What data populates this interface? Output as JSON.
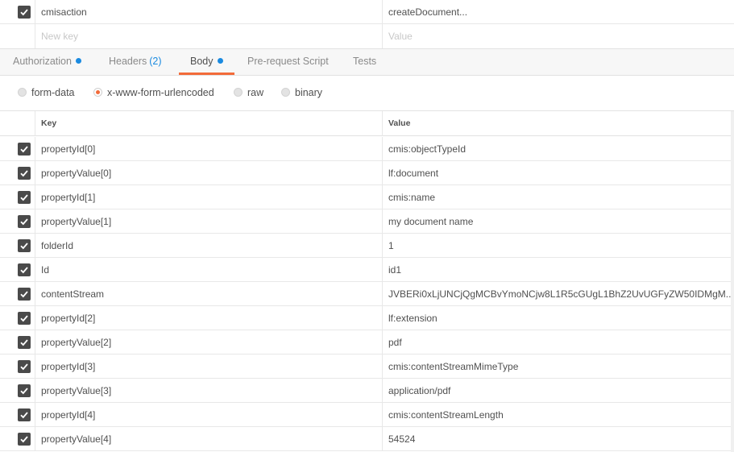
{
  "params": {
    "row": {
      "key": "cmisaction",
      "value": "createDocument..."
    },
    "new_key_placeholder": "New key",
    "new_value_placeholder": "Value"
  },
  "tabs": [
    {
      "label": "Authorization",
      "dot": true
    },
    {
      "label": "Headers",
      "count": "(2)"
    },
    {
      "label": "Body",
      "dot": true,
      "active": true
    },
    {
      "label": "Pre-request Script"
    },
    {
      "label": "Tests"
    }
  ],
  "body_modes": [
    {
      "label": "form-data",
      "selected": false
    },
    {
      "label": "x-www-form-urlencoded",
      "selected": true
    },
    {
      "label": "raw",
      "selected": false
    },
    {
      "label": "binary",
      "selected": false
    }
  ],
  "table": {
    "header_key": "Key",
    "header_value": "Value",
    "rows": [
      {
        "key": "propertyId[0]",
        "value": "cmis:objectTypeId"
      },
      {
        "key": "propertyValue[0]",
        "value": "lf:document"
      },
      {
        "key": "propertyId[1]",
        "value": "cmis:name"
      },
      {
        "key": "propertyValue[1]",
        "value": "my document name"
      },
      {
        "key": "folderId",
        "value": "1"
      },
      {
        "key": "Id",
        "value": "id1"
      },
      {
        "key": "contentStream",
        "value": "JVBERi0xLjUNCjQgMCBvYmoNCjw8L1R5cGUgL1BhZ2UvUGFyZW50IDMgM..."
      },
      {
        "key": "propertyId[2]",
        "value": "lf:extension"
      },
      {
        "key": "propertyValue[2]",
        "value": "pdf"
      },
      {
        "key": "propertyId[3]",
        "value": "cmis:contentStreamMimeType"
      },
      {
        "key": "propertyValue[3]",
        "value": "application/pdf"
      },
      {
        "key": "propertyId[4]",
        "value": "cmis:contentStreamLength"
      },
      {
        "key": "propertyValue[4]",
        "value": "54524"
      }
    ]
  },
  "colors": {
    "accent_orange": "#f26b3a",
    "accent_blue": "#1a8ae0",
    "checkbox": "#4a4a4a"
  }
}
